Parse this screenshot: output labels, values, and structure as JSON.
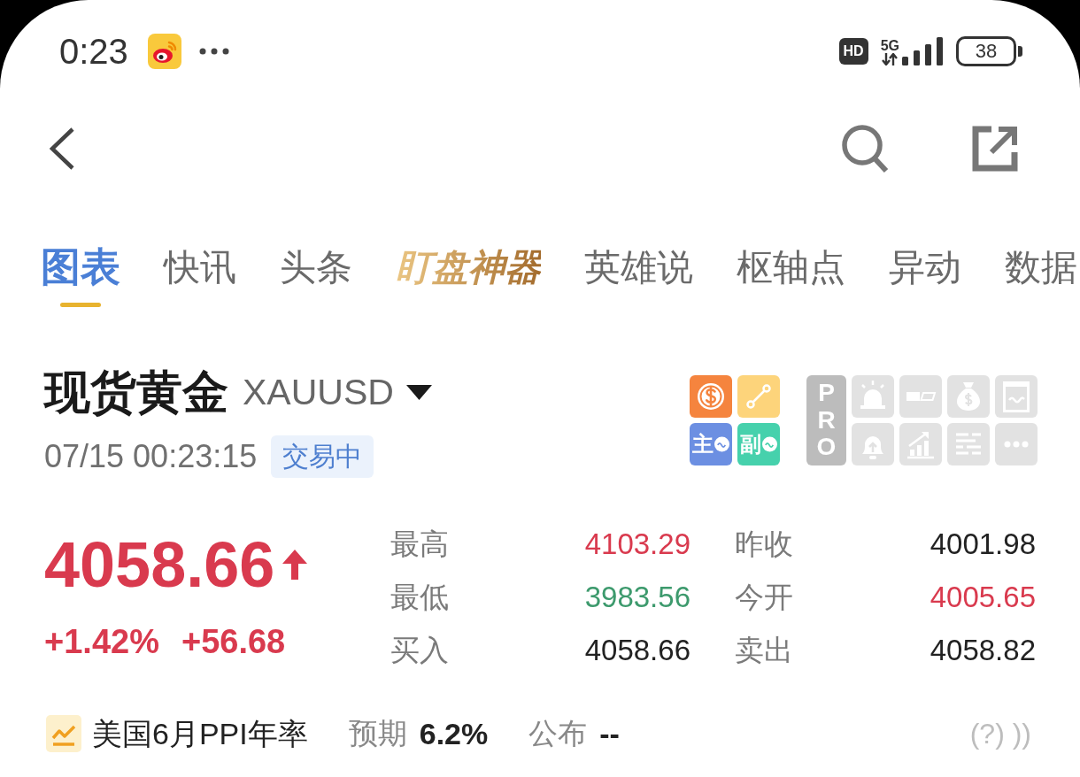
{
  "status_bar": {
    "time": "0:23",
    "hd_badge": "HD",
    "network": "5G",
    "battery": "38"
  },
  "tabs": [
    {
      "label": "图表",
      "selected": true,
      "kind": "text"
    },
    {
      "label": "快讯",
      "selected": false,
      "kind": "text"
    },
    {
      "label": "头条",
      "selected": false,
      "kind": "text"
    },
    {
      "label": "盯盘神器",
      "selected": false,
      "kind": "promo"
    },
    {
      "label": "英雄说",
      "selected": false,
      "kind": "text"
    },
    {
      "label": "枢轴点",
      "selected": false,
      "kind": "text"
    },
    {
      "label": "异动",
      "selected": false,
      "kind": "text"
    },
    {
      "label": "数据",
      "selected": false,
      "kind": "text"
    }
  ],
  "instrument": {
    "name": "现货黄金",
    "symbol": "XAUUSD",
    "timestamp": "07/15 00:23:15",
    "status": "交易中"
  },
  "tools": {
    "indicator_tiles": [
      {
        "label": "主"
      },
      {
        "label": "副"
      }
    ],
    "pro_label": "PRO"
  },
  "quote": {
    "price": "4058.66",
    "rising": true,
    "change_percent": "+1.42%",
    "change": "+56.68"
  },
  "stats": [
    {
      "label": "最高",
      "value": "4103.29",
      "color": "#d93a4e"
    },
    {
      "label": "昨收",
      "value": "4001.98",
      "color": "#222222"
    },
    {
      "label": "最低",
      "value": "3983.56",
      "color": "#3d9a6d"
    },
    {
      "label": "今开",
      "value": "4005.65",
      "color": "#d93a4e"
    },
    {
      "label": "买入",
      "value": "4058.66",
      "color": "#222222"
    },
    {
      "label": "卖出",
      "value": "4058.82",
      "color": "#222222"
    }
  ],
  "event": {
    "title": "美国6月PPI年率",
    "forecast_label": "预期",
    "forecast": "6.2%",
    "actual_label": "公布",
    "actual": "--",
    "trailing": "(?) ))"
  }
}
